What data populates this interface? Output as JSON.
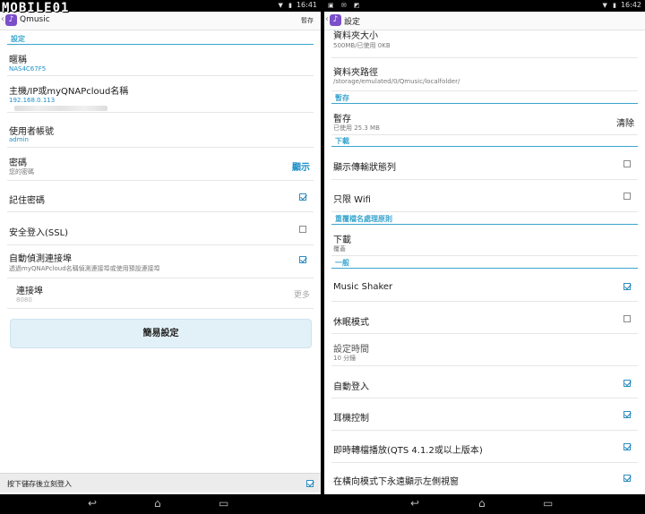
{
  "watermark": "MOBILE01",
  "left": {
    "status_time": "16:41",
    "status_icons": "▼ ▮",
    "title": "Qmusic",
    "action": "暫存",
    "section": "設定",
    "nickname": {
      "label": "暱稱",
      "value": "NAS4C67F5"
    },
    "host": {
      "label": "主機/IP或myQNAPcloud名稱",
      "value": "192.168.0.113"
    },
    "username": {
      "label": "使用者帳號",
      "value": "admin"
    },
    "password": {
      "label": "密碼",
      "sub": "您的密碼",
      "action": "顯示"
    },
    "remember": {
      "label": "記住密碼",
      "checked": true
    },
    "ssl": {
      "label": "安全登入(SSL)",
      "checked": false
    },
    "autodetect": {
      "label": "自動偵測連接埠",
      "sub": "透過myQNAPcloud名稱偵測連接埠或使用預設連接埠",
      "checked": true
    },
    "port": {
      "label": "連接埠",
      "sub": "8080",
      "action": "更多"
    },
    "easy_setup": "簡易設定",
    "save_login": {
      "label": "按下儲存後立刻登入",
      "checked": true
    }
  },
  "right": {
    "status_time": "16:42",
    "status_left_icons": "▣ ✉ ◩",
    "status_icons": "▼ ▮",
    "title": "設定",
    "folder_size": {
      "label": "資料夾大小",
      "value": "500MB/已使用 0KB"
    },
    "folder_path": {
      "label": "資料夾路徑",
      "value": "/storage/emulated/0/Qmusic/localfolder/"
    },
    "cache_section": "暫存",
    "cache": {
      "label": "暫存",
      "sub": "已使用 25.3 MB",
      "action": "清除"
    },
    "download_section": "下載",
    "show_transfer": {
      "label": "顯示傳輸狀態列",
      "checked": false
    },
    "wifi_only": {
      "label": "只限 Wifi",
      "checked": false
    },
    "duplicate_section": "重覆檔名處理原則",
    "download_rule": {
      "label": "下載",
      "value": "覆蓋"
    },
    "general_section": "一般",
    "music_shaker": {
      "label": "Music Shaker",
      "checked": true
    },
    "sleep_mode": {
      "label": "休眠模式",
      "checked": false
    },
    "timer": {
      "label": "設定時間",
      "value": "10 分鐘"
    },
    "auto_login": {
      "label": "自動登入",
      "checked": true
    },
    "headset": {
      "label": "耳機控制",
      "checked": true
    },
    "instant_transcode": {
      "label": "即時轉檔播放(QTS 4.1.2或以上版本)",
      "checked": true
    },
    "landscape_left": {
      "label": "在橫向模式下永遠顯示左側視窗",
      "checked": true
    }
  }
}
